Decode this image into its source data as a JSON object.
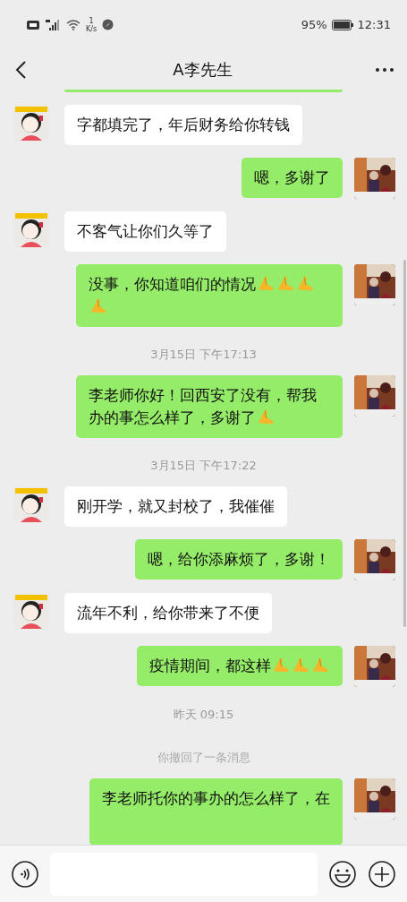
{
  "status_bar": {
    "speed_value": "1",
    "speed_unit": "K/s",
    "battery_text": "95%",
    "time": "12:31"
  },
  "header": {
    "title": "A李先生"
  },
  "messages": [
    {
      "kind": "in",
      "text": "字都填完了，年后财务给你转钱"
    },
    {
      "kind": "out",
      "text": "嗯，多谢了"
    },
    {
      "kind": "in",
      "text": "不客气让你们久等了"
    },
    {
      "kind": "out",
      "text": "没事，你知道咱们的情况",
      "emojis": [
        {
          "kind": "pray"
        },
        {
          "kind": "pray"
        },
        {
          "kind": "pray"
        },
        {
          "kind": "pray"
        }
      ]
    },
    {
      "kind": "time",
      "text": "3月15日 下午17:13"
    },
    {
      "kind": "out",
      "text": "李老师你好！回西安了没有，帮我办的事怎么样了，多谢了",
      "emojis": [
        {
          "kind": "pray"
        }
      ]
    },
    {
      "kind": "time",
      "text": "3月15日 下午17:22"
    },
    {
      "kind": "in",
      "text": "刚开学，就又封校了，我催催"
    },
    {
      "kind": "out",
      "text": "嗯，给你添麻烦了，多谢！"
    },
    {
      "kind": "in",
      "text": "流年不利，给你带来了不便"
    },
    {
      "kind": "out",
      "text": "疫情期间，都这样",
      "emojis": [
        {
          "kind": "pray"
        },
        {
          "kind": "pray"
        },
        {
          "kind": "pray"
        }
      ]
    },
    {
      "kind": "time",
      "text": "昨天 09:15"
    },
    {
      "kind": "notice",
      "text": "你撤回了一条消息"
    },
    {
      "kind": "out_cut",
      "text": "李老师托你的事办的怎么样了，在"
    }
  ]
}
